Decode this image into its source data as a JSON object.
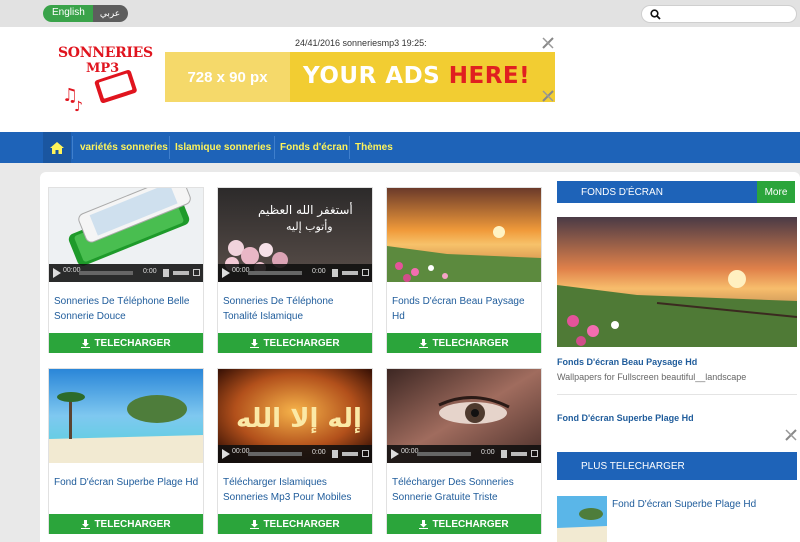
{
  "topbar": {
    "lang_english": "English",
    "lang_arabic": "عربي",
    "search": {
      "placeholder": ""
    }
  },
  "header": {
    "logo_line1": "SONNERIES",
    "logo_line2": "MP3",
    "datetime": "24/41/2016 sonneriesmp3 19:25:",
    "ad": {
      "size": "728 x 90 px",
      "message_main": "YOUR ADS ",
      "message_accent": "HERE!"
    }
  },
  "nav": {
    "home_icon": "home-icon",
    "items": [
      {
        "label": "variétés sonneries"
      },
      {
        "label": "Islamique sonneries"
      },
      {
        "label": "Fonds d'écran"
      },
      {
        "label": "Thèmes"
      }
    ]
  },
  "cards": [
    {
      "title": "Sonneries De Téléphone Belle Sonnerie Douce",
      "has_player": true,
      "player_time": "00:00",
      "player_end": "0:00",
      "button": "TELECHARGER"
    },
    {
      "title": "Sonneries De Téléphone Tonalité Islamique",
      "has_player": true,
      "player_time": "00:00",
      "player_end": "0:00",
      "button": "TELECHARGER"
    },
    {
      "title": "Fonds D'écran Beau Paysage Hd",
      "has_player": false,
      "button": "TELECHARGER"
    },
    {
      "title": "Fond D'écran Superbe Plage Hd",
      "has_player": false,
      "button": "TELECHARGER"
    },
    {
      "title": "Télécharger Islamiques Sonneries Mp3 Pour Mobiles",
      "has_player": true,
      "player_time": "00:00",
      "player_end": "0:00",
      "button": "TELECHARGER"
    },
    {
      "title": "Télécharger Des Sonneries Sonnerie Gratuite Triste",
      "has_player": true,
      "player_time": "00:00",
      "player_end": "0:00",
      "button": "TELECHARGER"
    }
  ],
  "sidebar": {
    "fonds_heading": "FONDS D'ÉCRAN",
    "more_label": "More",
    "featured_title": "Fonds D'écran Beau Paysage Hd",
    "featured_desc": "Wallpapers for Fullscreen beautiful__landscape",
    "second_title": "Fond D'écran Superbe Plage Hd",
    "plus_heading": "PLUS TELECHARGER",
    "plus_item_title": "Fond D'écran Superbe Plage Hd"
  },
  "colors": {
    "nav_blue": "#1e63b8",
    "green": "#2ba53b",
    "link_blue": "#1f5c9b",
    "nav_text": "#fff45a"
  }
}
